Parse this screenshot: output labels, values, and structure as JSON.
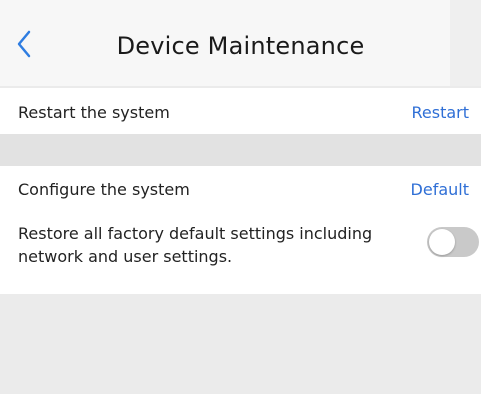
{
  "header": {
    "title": "Device Maintenance",
    "back_icon": "chevron-left-icon"
  },
  "restart": {
    "label": "Restart the system",
    "action": "Restart"
  },
  "configure": {
    "label": "Configure the system",
    "action": "Default"
  },
  "factory_restore": {
    "description": "Restore all factory default settings including network and user settings.",
    "enabled": false
  },
  "colors": {
    "accent": "#2f6fd6",
    "toggle_off": "#c9c9c9",
    "background": "#ebebeb"
  }
}
